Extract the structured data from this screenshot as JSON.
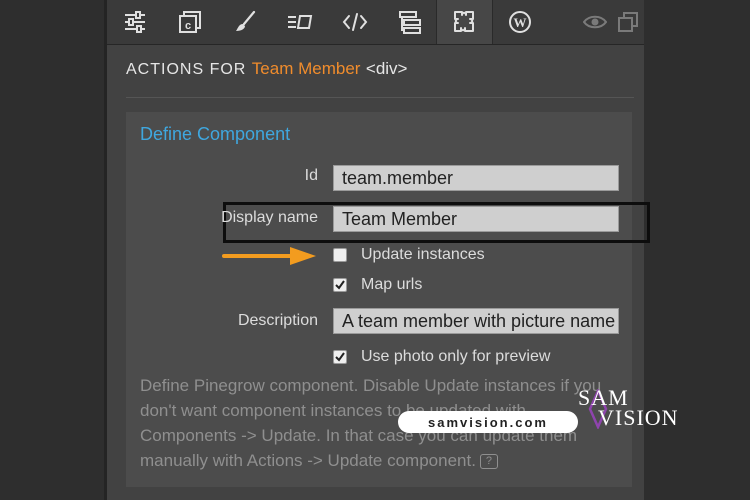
{
  "toolbar": {
    "tools": [
      {
        "name": "properties-icon"
      },
      {
        "name": "components-icon"
      },
      {
        "name": "style-brush-icon"
      },
      {
        "name": "library-icon"
      },
      {
        "name": "code-icon"
      },
      {
        "name": "tree-icon"
      },
      {
        "name": "actions-puzzle-icon"
      },
      {
        "name": "wordpress-icon"
      },
      {
        "name": "eye-icon"
      },
      {
        "name": "duplicate-icon"
      }
    ],
    "active": "actions-puzzle-icon"
  },
  "actions": {
    "heading_prefix": "ACTIONS FOR",
    "component_name": "Team Member",
    "element_tag": "<div>"
  },
  "define_component": {
    "title": "Define Component",
    "id_label": "Id",
    "id_value": "team.member",
    "display_name_label": "Display name",
    "display_name_value": "Team Member",
    "update_instances_label": "Update instances",
    "update_instances_checked": false,
    "map_urls_label": "Map urls",
    "map_urls_checked": true,
    "description_label": "Description",
    "description_value": "A team member with picture name",
    "use_photo_label": "Use photo only for preview",
    "use_photo_checked": true,
    "help_text": "Define Pinegrow component. Disable Update instances if you don't want component instances to be updated with Components -> Update. In that case you can update them manually with Actions -> Update component."
  },
  "annotations": {
    "arrow_color": "#f39c1f",
    "highlight_color": "#0d0d0d"
  },
  "watermark": {
    "url": "samvision.com",
    "logo_line1": "SAM",
    "logo_line2": "VISION"
  },
  "colors": {
    "accent_orange": "#f08c2c",
    "accent_blue": "#3fa7df",
    "panel_bg": "#424242",
    "card_bg": "#4c4c4c"
  }
}
